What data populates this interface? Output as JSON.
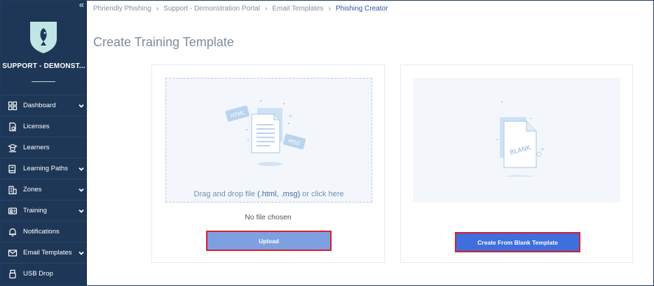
{
  "sidebar": {
    "collapse_glyph": "«",
    "org_name": "SUPPORT - DEMONST...",
    "items": [
      {
        "label": "Dashboard",
        "icon": "dashboard-icon",
        "has_submenu": true
      },
      {
        "label": "Licenses",
        "icon": "license-icon",
        "has_submenu": false
      },
      {
        "label": "Learners",
        "icon": "learners-icon",
        "has_submenu": false
      },
      {
        "label": "Learning Paths",
        "icon": "book-icon",
        "has_submenu": true
      },
      {
        "label": "Zones",
        "icon": "building-icon",
        "has_submenu": true
      },
      {
        "label": "Training",
        "icon": "training-icon",
        "has_submenu": true
      },
      {
        "label": "Notifications",
        "icon": "bell-icon",
        "has_submenu": false
      },
      {
        "label": "Email Templates",
        "icon": "envelope-icon",
        "has_submenu": true
      },
      {
        "label": "USB Drop",
        "icon": "usb-icon",
        "has_submenu": false
      }
    ]
  },
  "breadcrumb": {
    "items": [
      "Phriendly Phishing",
      "Support - Demonstration Portal",
      "Email Templates"
    ],
    "current": "Phishing Creator"
  },
  "page": {
    "title": "Create Training Template"
  },
  "upload_card": {
    "badge_html": "HTML",
    "badge_msg": "MSG",
    "drop_text_prefix": "Drag and drop file ",
    "drop_text_ext": "(.html, .msg)",
    "drop_text_suffix": " or click here",
    "no_file": "No file chosen",
    "button_label": "Upload"
  },
  "blank_card": {
    "doc_label": "BLANK",
    "button_label": "Create From Blank Template"
  },
  "colors": {
    "sidebar_bg": "#1e3757",
    "primary_button": "#3f6fdd",
    "upload_button": "#7fa0e0",
    "highlight_border": "#d6202a",
    "breadcrumb_active": "#2d55a5"
  }
}
